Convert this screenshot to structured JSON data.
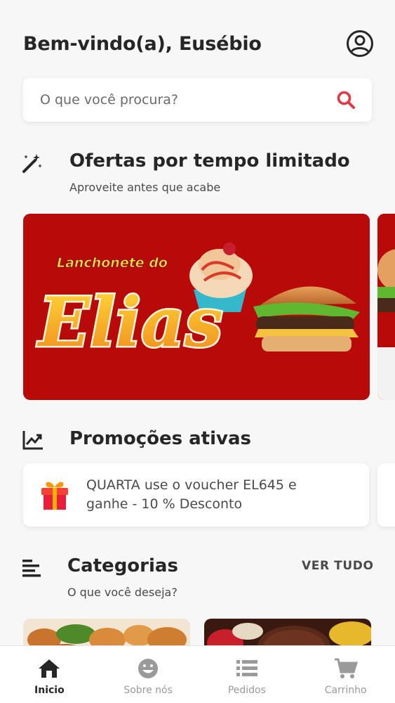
{
  "header": {
    "greeting": "Bem-vindo(a), Eusébio",
    "profile_icon": "account-circle-icon"
  },
  "search": {
    "placeholder": "O que você procura?",
    "icon": "search-icon",
    "icon_color": "#e23744"
  },
  "offers": {
    "title": "Ofertas por tempo limitado",
    "subtitle": "Aproveite antes que acabe",
    "icon": "magic-wand-icon",
    "banner": {
      "line1": "Lanchonete do",
      "line2": "Elias",
      "background": "#b80a08"
    }
  },
  "promotions": {
    "title": "Promoções ativas",
    "icon": "trending-up-icon",
    "cards": [
      {
        "icon": "gift-icon",
        "text": "QUARTA use o voucher EL645 e ganhe - 10 % Desconto"
      }
    ]
  },
  "categories": {
    "title": "Categorias",
    "subtitle": "O que você deseja?",
    "icon": "sort-lines-icon",
    "see_all": "VER TUDO"
  },
  "bottom_nav": {
    "items": [
      {
        "label": "Inicio",
        "icon": "home-icon",
        "active": true
      },
      {
        "label": "Sobre nós",
        "icon": "smile-icon",
        "active": false
      },
      {
        "label": "Pedidos",
        "icon": "list-icon",
        "active": false
      },
      {
        "label": "Carrinho",
        "icon": "cart-icon",
        "active": false
      }
    ]
  },
  "colors": {
    "accent": "#e23744",
    "text_dark": "#262626",
    "text_muted": "#9a9a9a",
    "background": "#f7f7f8"
  }
}
